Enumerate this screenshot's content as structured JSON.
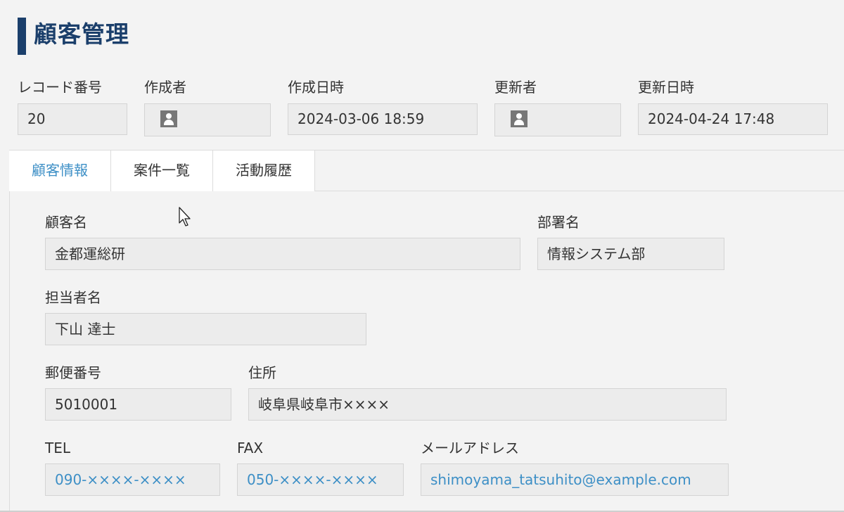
{
  "header": {
    "title": "顧客管理"
  },
  "meta": {
    "record_number": {
      "label": "レコード番号",
      "value": "20"
    },
    "creator": {
      "label": "作成者",
      "value": ""
    },
    "created_at": {
      "label": "作成日時",
      "value": "2024-03-06 18:59"
    },
    "updater": {
      "label": "更新者",
      "value": ""
    },
    "updated_at": {
      "label": "更新日時",
      "value": "2024-04-24 17:48"
    }
  },
  "tabs": [
    {
      "label": "顧客情報",
      "active": true
    },
    {
      "label": "案件一覧",
      "active": false
    },
    {
      "label": "活動履歴",
      "active": false
    }
  ],
  "fields": {
    "customer_name": {
      "label": "顧客名",
      "value": "金都運総研"
    },
    "department": {
      "label": "部署名",
      "value": "情報システム部"
    },
    "contact_person": {
      "label": "担当者名",
      "value": "下山 達士"
    },
    "postal_code": {
      "label": "郵便番号",
      "value": "5010001"
    },
    "address": {
      "label": "住所",
      "value": "岐阜県岐阜市××××"
    },
    "tel": {
      "label": "TEL",
      "value": "090-××××-××××"
    },
    "fax": {
      "label": "FAX",
      "value": "050-××××-××××"
    },
    "email": {
      "label": "メールアドレス",
      "value": "shimoyama_tatsuhito@example.com"
    }
  },
  "icons": {
    "user": "user-icon",
    "cursor": "mouse-pointer-icon"
  },
  "colors": {
    "title": "#1b3f6b",
    "link": "#3d8fc6",
    "active_tab": "#3d8fc6"
  }
}
